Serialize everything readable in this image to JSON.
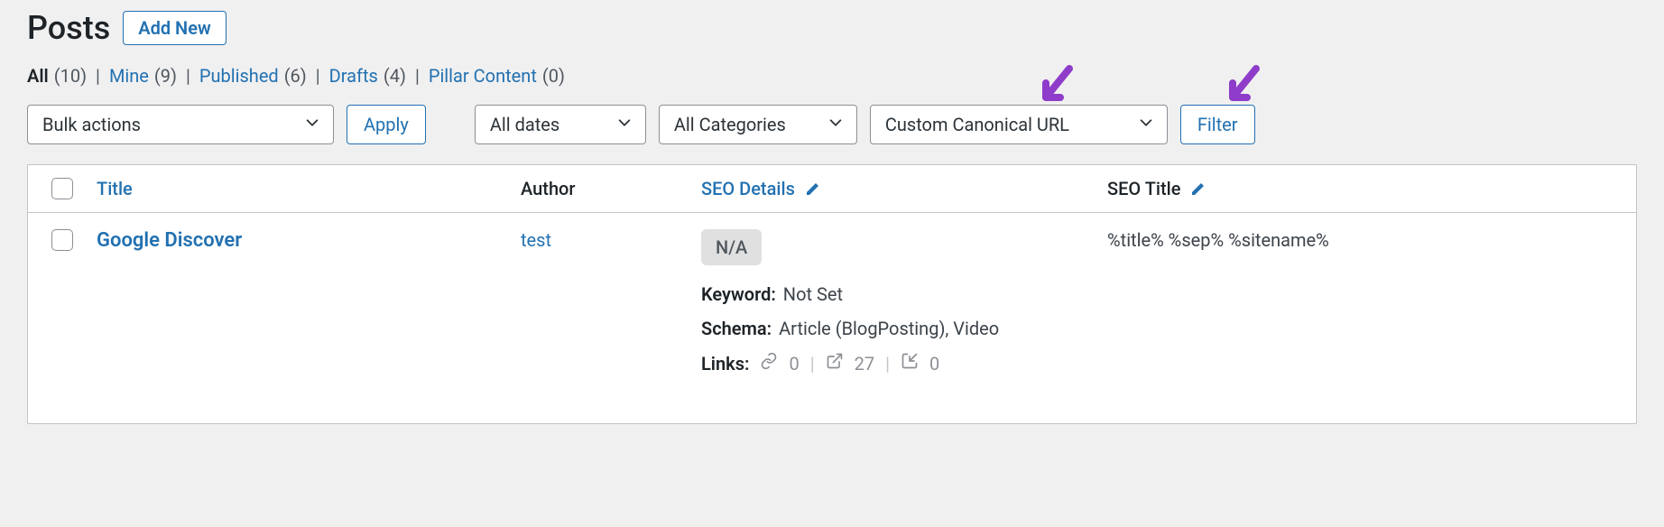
{
  "header": {
    "title": "Posts",
    "add_new": "Add New"
  },
  "filters": [
    {
      "label": "All",
      "count": "(10)",
      "active": true
    },
    {
      "label": "Mine",
      "count": "(9)",
      "active": false
    },
    {
      "label": "Published",
      "count": "(6)",
      "active": false
    },
    {
      "label": "Drafts",
      "count": "(4)",
      "active": false
    },
    {
      "label": "Pillar Content",
      "count": "(0)",
      "active": false
    }
  ],
  "toolbar": {
    "bulk": "Bulk actions",
    "apply": "Apply",
    "dates": "All dates",
    "categories": "All Categories",
    "seo_filter": "Custom Canonical URL",
    "filter": "Filter"
  },
  "table": {
    "headers": {
      "title": "Title",
      "author": "Author",
      "seo_details": "SEO Details",
      "seo_title": "SEO Title"
    },
    "rows": [
      {
        "title": "Google Discover",
        "author": "test",
        "badge": "N/A",
        "keyword_label": "Keyword:",
        "keyword_value": "Not Set",
        "schema_label": "Schema:",
        "schema_value": "Article (BlogPosting), Video",
        "links_label": "Links:",
        "links_internal": "0",
        "links_external": "27",
        "links_incoming": "0",
        "seo_title": "%title% %sep% %sitename%"
      }
    ]
  }
}
